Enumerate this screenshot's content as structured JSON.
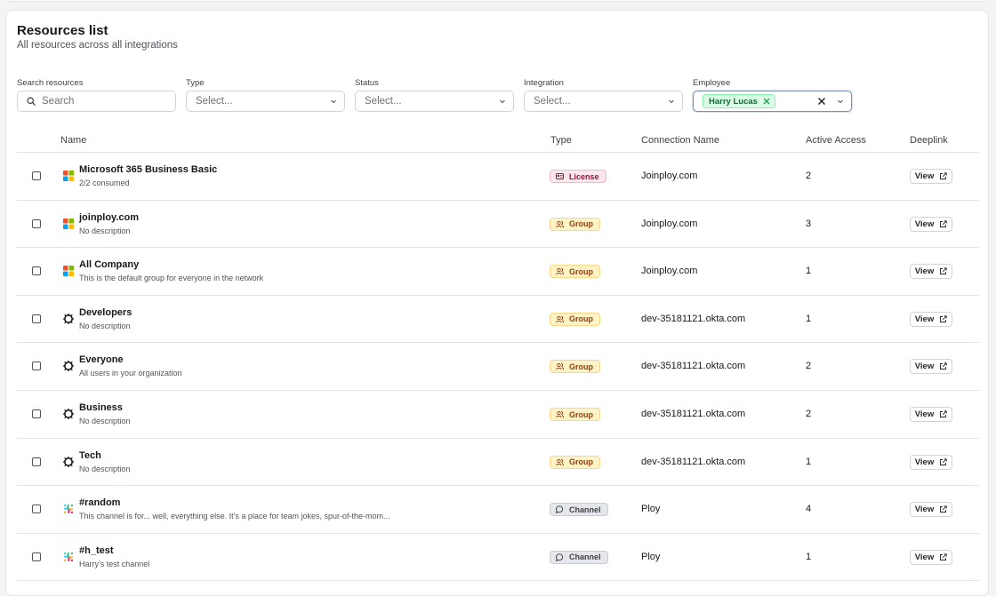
{
  "header": {
    "title": "Resources list",
    "subtitle": "All resources across all integrations"
  },
  "filters": {
    "search": {
      "label": "Search resources",
      "placeholder": "Search"
    },
    "type": {
      "label": "Type",
      "placeholder": "Select..."
    },
    "status": {
      "label": "Status",
      "placeholder": "Select..."
    },
    "integration": {
      "label": "Integration",
      "placeholder": "Select..."
    },
    "employee": {
      "label": "Employee",
      "selected": "Harry Lucas"
    }
  },
  "table": {
    "columns": {
      "name": "Name",
      "type": "Type",
      "connection": "Connection Name",
      "active": "Active Access",
      "deeplink": "Deeplink"
    },
    "rows": [
      {
        "icon": "microsoft-icon",
        "name": "Microsoft 365 Business Basic",
        "desc": "2/2 consumed",
        "type": "License",
        "typeKind": "license",
        "connection": "Joinploy.com",
        "active": "2",
        "view": "View"
      },
      {
        "icon": "microsoft-icon",
        "name": "joinploy.com",
        "desc": "No description",
        "type": "Group",
        "typeKind": "group",
        "connection": "Joinploy.com",
        "active": "3",
        "view": "View"
      },
      {
        "icon": "microsoft-icon",
        "name": "All Company",
        "desc": "This is the default group for everyone in the network",
        "type": "Group",
        "typeKind": "group",
        "connection": "Joinploy.com",
        "active": "1",
        "view": "View"
      },
      {
        "icon": "okta-icon",
        "name": "Developers",
        "desc": "No description",
        "type": "Group",
        "typeKind": "group",
        "connection": "dev-35181121.okta.com",
        "active": "1",
        "view": "View"
      },
      {
        "icon": "okta-icon",
        "name": "Everyone",
        "desc": "All users in your organization",
        "type": "Group",
        "typeKind": "group",
        "connection": "dev-35181121.okta.com",
        "active": "2",
        "view": "View"
      },
      {
        "icon": "okta-icon",
        "name": "Business",
        "desc": "No description",
        "type": "Group",
        "typeKind": "group",
        "connection": "dev-35181121.okta.com",
        "active": "2",
        "view": "View"
      },
      {
        "icon": "okta-icon",
        "name": "Tech",
        "desc": "No description",
        "type": "Group",
        "typeKind": "group",
        "connection": "dev-35181121.okta.com",
        "active": "1",
        "view": "View"
      },
      {
        "icon": "slack-icon",
        "name": "#random",
        "desc": "This channel is for... well, everything else. It’s a place for team jokes, spur-of-the-mom...",
        "type": "Channel",
        "typeKind": "channel",
        "connection": "Ploy",
        "active": "4",
        "view": "View"
      },
      {
        "icon": "slack-icon",
        "name": "#h_test",
        "desc": "Harry's test channel",
        "type": "Channel",
        "typeKind": "channel",
        "connection": "Ploy",
        "active": "1",
        "view": "View"
      }
    ]
  }
}
